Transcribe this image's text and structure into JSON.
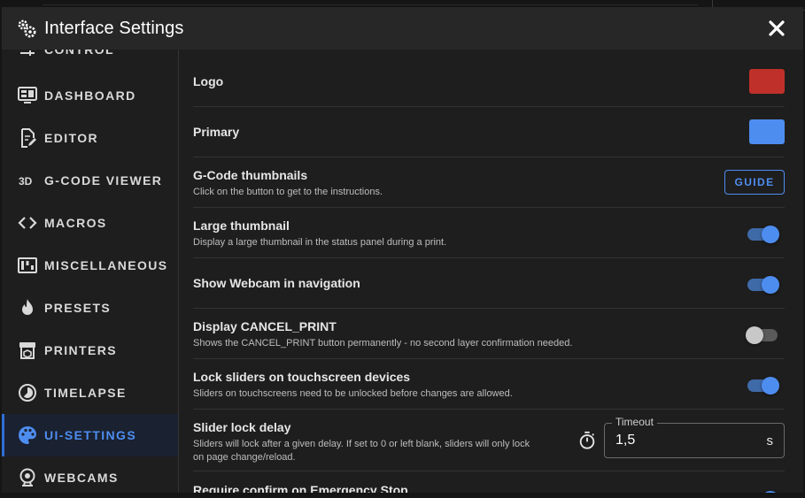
{
  "dialog": {
    "title": "Interface Settings",
    "header_icon": "cogs-icon",
    "close_icon": "close-icon"
  },
  "sidebar": {
    "partial_top_label": "CONTROL",
    "items": [
      {
        "label": "DASHBOARD",
        "icon": "monitor-dashboard-icon"
      },
      {
        "label": "EDITOR",
        "icon": "file-edit-icon"
      },
      {
        "label": "G-CODE VIEWER",
        "icon": "3d-icon"
      },
      {
        "label": "MACROS",
        "icon": "code-brackets-icon"
      },
      {
        "label": "MISCELLANEOUS",
        "icon": "dip-switches-icon"
      },
      {
        "label": "PRESETS",
        "icon": "fire-icon"
      },
      {
        "label": "PRINTERS",
        "icon": "printer-3d-icon"
      },
      {
        "label": "TIMELAPSE",
        "icon": "timelapse-icon"
      },
      {
        "label": "UI-SETTINGS",
        "icon": "palette-icon",
        "active": true
      },
      {
        "label": "WEBCAMS",
        "icon": "webcam-icon"
      }
    ]
  },
  "settings": {
    "logo": {
      "title": "Logo",
      "color": "#c0302a"
    },
    "primary": {
      "title": "Primary",
      "color": "#4e8df0"
    },
    "gcode_thumbnails": {
      "title": "G-Code thumbnails",
      "subtitle": "Click on the button to get to the instructions.",
      "button": "GUIDE"
    },
    "large_thumbnail": {
      "title": "Large thumbnail",
      "subtitle": "Display a large thumbnail in the status panel during a print.",
      "enabled": true
    },
    "show_webcam": {
      "title": "Show Webcam in navigation",
      "enabled": true
    },
    "cancel_print": {
      "title": "Display CANCEL_PRINT",
      "subtitle": "Shows the CANCEL_PRINT button permanently - no second layer confirmation needed.",
      "enabled": false
    },
    "lock_sliders": {
      "title": "Lock sliders on touchscreen devices",
      "subtitle": "Sliders on touchscreens need to be unlocked before changes are allowed.",
      "enabled": true
    },
    "slider_lock_delay": {
      "title": "Slider lock delay",
      "subtitle_line1": "Sliders will lock after a given delay. If set to 0 or left blank, sliders will only lock",
      "subtitle_line2": "on page change/reload.",
      "field_label": "Timeout",
      "value": "1,5",
      "suffix": "s",
      "icon": "timer-icon"
    },
    "emergency_stop": {
      "title": "Require confirm on Emergency Stop"
    }
  },
  "colors": {
    "accent": "#4e8df0",
    "background": "#1e1e1e",
    "header": "#272727"
  }
}
